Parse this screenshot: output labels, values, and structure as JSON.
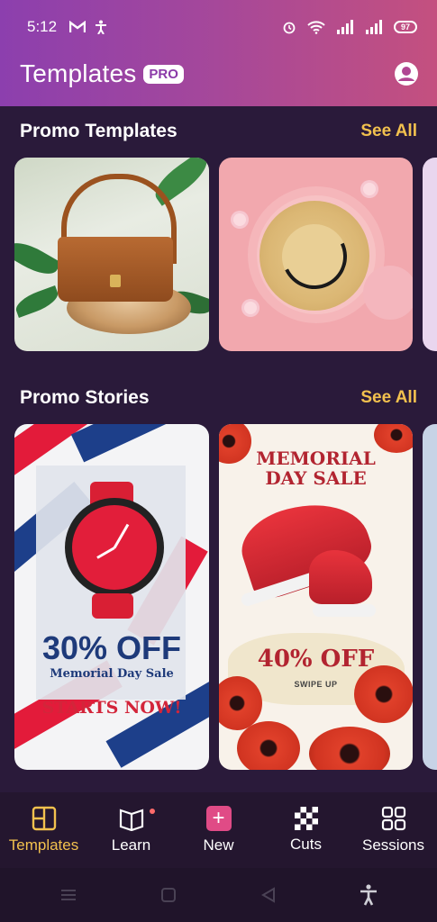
{
  "status_bar": {
    "time": "5:12",
    "battery": "97"
  },
  "header": {
    "title": "Templates",
    "badge": "PRO"
  },
  "sections": {
    "promo_templates": {
      "title": "Promo Templates",
      "see_all": "See All"
    },
    "promo_stories": {
      "title": "Promo Stories",
      "see_all": "See All"
    }
  },
  "stories": {
    "watch": {
      "discount": "30% OFF",
      "subtitle": "Memorial Day Sale",
      "cta": "STARTS NOW!"
    },
    "shoe": {
      "title_line1": "MEMORIAL",
      "title_line2": "DAY SALE",
      "discount": "40% OFF",
      "cta": "SWIPE UP"
    }
  },
  "bottom_nav": [
    {
      "label": "Templates",
      "icon": "templates-icon",
      "active": true
    },
    {
      "label": "Learn",
      "icon": "book-icon",
      "active": false
    },
    {
      "label": "New",
      "icon": "plus-icon",
      "active": false
    },
    {
      "label": "Cuts",
      "icon": "checker-icon",
      "active": false
    },
    {
      "label": "Sessions",
      "icon": "grid-icon",
      "active": false
    }
  ],
  "colors": {
    "accent": "#f2c14e",
    "new_button": "#e04b86",
    "background": "#2a1a3a"
  }
}
